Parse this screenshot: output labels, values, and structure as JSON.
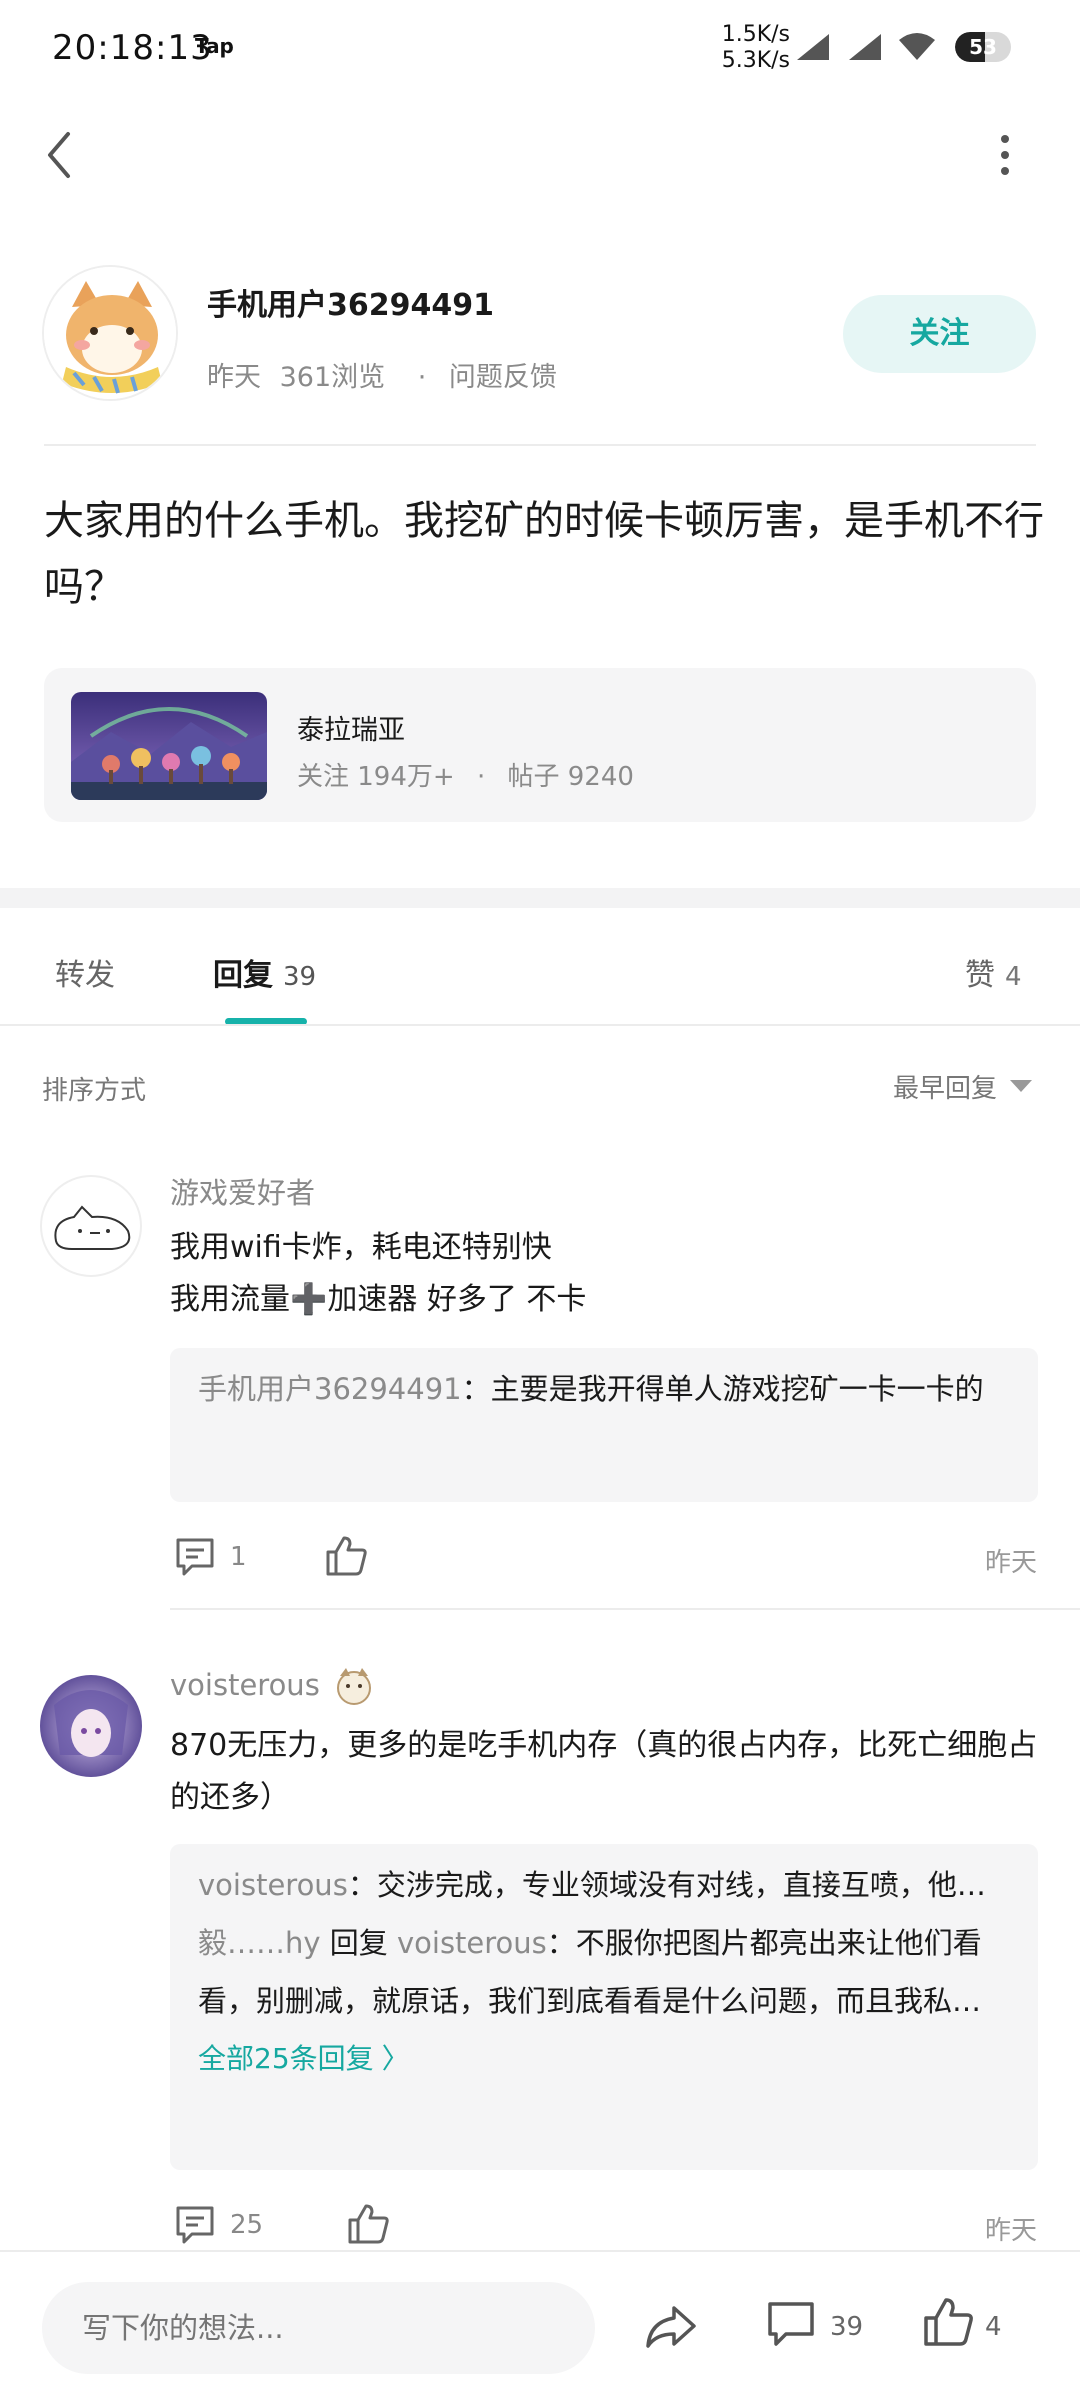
{
  "status_bar": {
    "time": "20:18:13",
    "app_tag": "Tap",
    "speed_up": "1.5K/s",
    "speed_down": "5.3K/s",
    "battery": "53"
  },
  "author": {
    "name": "手机用户36294491",
    "meta_day": "昨天",
    "meta_views": "361浏览",
    "meta_dot": "·",
    "meta_category": "问题反馈",
    "follow_label": "关注"
  },
  "post": {
    "title": "大家用的什么手机。我挖矿的时候卡顿厉害，是手机不行吗？"
  },
  "forum": {
    "name": "泰拉瑞亚",
    "followers": "关注 194万+",
    "dot": "·",
    "posts": "帖子 9240"
  },
  "tabs": {
    "forward": "转发",
    "reply": "回复",
    "reply_count": "39",
    "like": "赞",
    "like_count": "4"
  },
  "sort": {
    "label": "排序方式",
    "value": "最早回复"
  },
  "comments": [
    {
      "user": "游戏爱好者",
      "body_line1": "我用wifi卡炸，耗电还特别快",
      "body_line2": "我用流量➕加速器 好多了  不卡",
      "quote_user": "手机用户36294491",
      "quote_text": "：主要是我开得单人游戏挖矿一卡一卡的",
      "reply_count": "1",
      "time": "昨天"
    },
    {
      "user": "voisterous",
      "body": "870无压力，更多的是吃手机内存（真的很占内存，比死亡细胞占的还多）",
      "quote1_user": "voisterous",
      "quote1_text": "：交涉完成，专业领域没有对线，直接互喷，他觉得自己没错，我也觉得自己没错。既然如此交给大家判断…",
      "quote2_user": "毅……hy",
      "quote2_mid": " 回复 ",
      "quote2_target": "voisterous",
      "quote2_text": "：不服你把图片都亮出来让他们看看，别删减，就原话，我们到底看看是什么问题，而且我私…",
      "more_replies": "全部25条回复",
      "reply_count": "25",
      "time": "昨天"
    }
  ],
  "bottom_bar": {
    "input_placeholder": "写下你的想法...",
    "comment_count": "39",
    "like_count": "4"
  },
  "colors": {
    "accent": "#16a8a0",
    "follow_bg": "#e6f6f5"
  }
}
